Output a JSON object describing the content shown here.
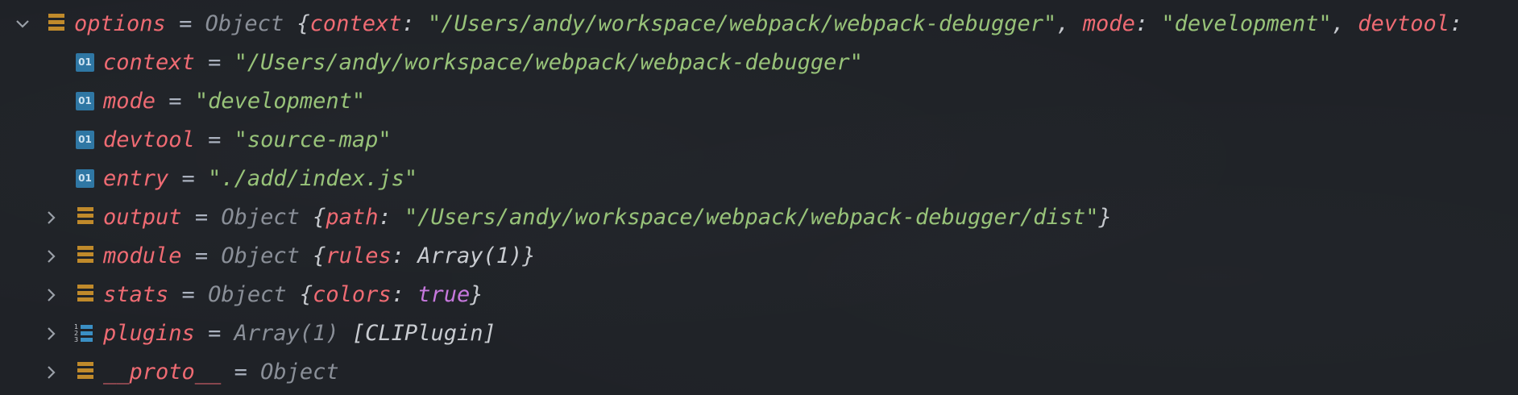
{
  "colors": {
    "background": "#1f2227",
    "key": "#ef6b73",
    "string": "#98c379",
    "type": "#8a8f98",
    "boolean": "#c678dd",
    "object_icon": "#c08a2b",
    "primitive_icon": "#2f77a4",
    "array_icon": "#3a8fc4"
  },
  "tree": {
    "root": {
      "name": "options",
      "eq": "=",
      "type": "Object",
      "open_brace": "{",
      "p1_key": "context",
      "p1_colon": ":",
      "p1_value": "\"/Users/andy/workspace/webpack/webpack-debugger\"",
      "comma1": ",",
      "p2_key": "mode",
      "p2_colon": ":",
      "p2_value": "\"development\"",
      "comma2": ",",
      "p3_key": "devtool",
      "p3_colon": ":",
      "expanded": true,
      "icon": "object-icon"
    },
    "context": {
      "icon_text": "01",
      "name": "context",
      "eq": "=",
      "value": "\"/Users/andy/workspace/webpack/webpack-debugger\""
    },
    "mode": {
      "icon_text": "01",
      "name": "mode",
      "eq": "=",
      "value": "\"development\""
    },
    "devtool": {
      "icon_text": "01",
      "name": "devtool",
      "eq": "=",
      "value": "\"source-map\""
    },
    "entry": {
      "icon_text": "01",
      "name": "entry",
      "eq": "=",
      "value": "\"./add/index.js\""
    },
    "output": {
      "name": "output",
      "eq": "=",
      "type": "Object",
      "open_brace": "{",
      "p_key": "path",
      "p_colon": ":",
      "p_value": "\"/Users/andy/workspace/webpack/webpack-debugger/dist\"",
      "close_brace": "}",
      "expanded": false
    },
    "module": {
      "name": "module",
      "eq": "=",
      "type": "Object",
      "open_brace": "{",
      "p_key": "rules",
      "p_colon": ":",
      "p_value": "Array(1)",
      "close_brace": "}",
      "expanded": false
    },
    "stats": {
      "name": "stats",
      "eq": "=",
      "type": "Object",
      "open_brace": "{",
      "p_key": "colors",
      "p_colon": ":",
      "p_value": "true",
      "close_brace": "}",
      "expanded": false
    },
    "plugins": {
      "icon_nums": [
        "1",
        "2",
        "3"
      ],
      "name": "plugins",
      "eq": "=",
      "type": "Array(1)",
      "preview": "[CLIPlugin]",
      "expanded": false
    },
    "proto": {
      "name": "__proto__",
      "eq": "=",
      "type": "Object",
      "expanded": false
    }
  }
}
